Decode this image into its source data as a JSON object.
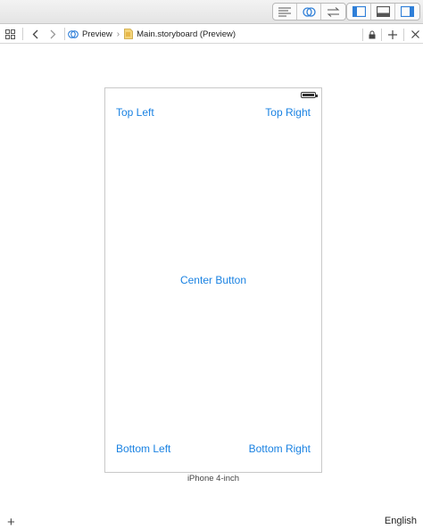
{
  "toolbar": {
    "editor_modes": [
      "standard-editor-icon",
      "assistant-editor-icon",
      "version-editor-icon"
    ],
    "view_toggles": [
      "navigator-panel-icon",
      "debug-area-icon",
      "utilities-panel-icon"
    ]
  },
  "jumpbar": {
    "crumbs": [
      {
        "label": "Preview",
        "icon": "assistant-icon"
      },
      {
        "label": "Main.storyboard (Preview)",
        "icon": "storyboard-file-icon"
      }
    ]
  },
  "preview": {
    "buttons": {
      "top_left": "Top Left",
      "top_right": "Top Right",
      "center": "Center Button",
      "bottom_left": "Bottom Left",
      "bottom_right": "Bottom Right"
    },
    "device_name": "iPhone 4-inch",
    "accent_color": "#1a82e2"
  },
  "footer": {
    "add_symbol": "+",
    "language": "English"
  }
}
